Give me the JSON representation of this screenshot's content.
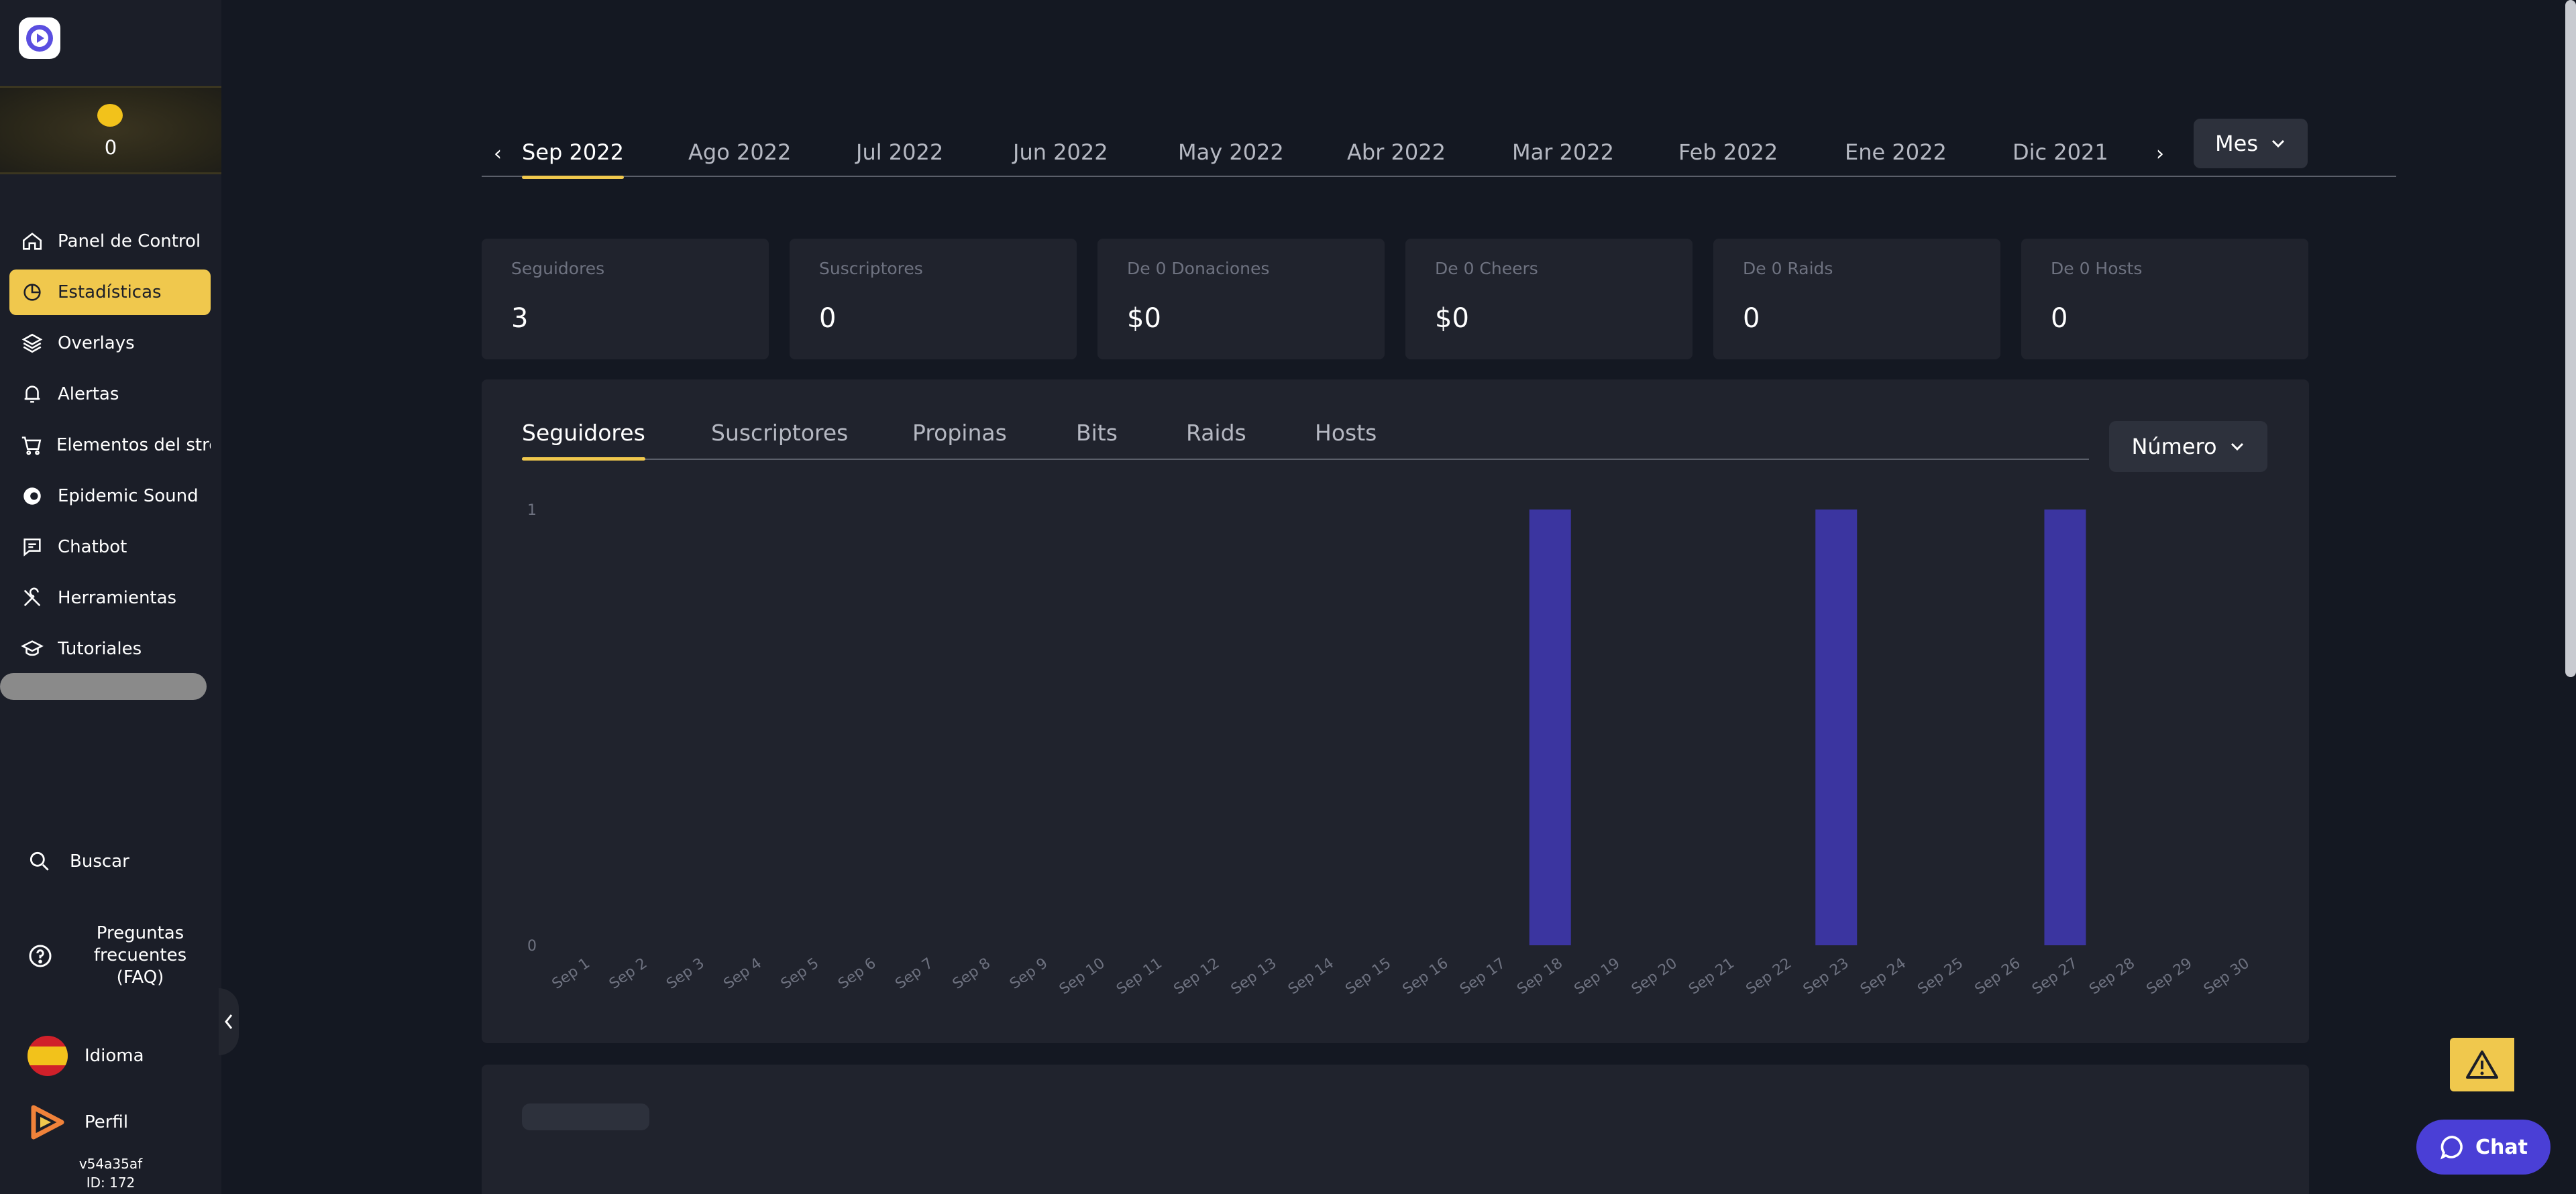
{
  "sidebar": {
    "coins": "0",
    "nav": [
      {
        "label": "Panel de Control",
        "icon": "home-icon"
      },
      {
        "label": "Estadísticas",
        "icon": "pie-chart-icon",
        "active": true
      },
      {
        "label": "Overlays",
        "icon": "layers-icon"
      },
      {
        "label": "Alertas",
        "icon": "bell-icon"
      },
      {
        "label": "Elementos del strea",
        "icon": "cart-icon"
      },
      {
        "label": "Epidemic Sound",
        "icon": "epidemic-sound-icon"
      },
      {
        "label": "Chatbot",
        "icon": "chat-bubble-icon"
      },
      {
        "label": "Herramientas",
        "icon": "tools-icon"
      },
      {
        "label": "Tutoriales",
        "icon": "graduation-cap-icon"
      }
    ],
    "search": "Buscar",
    "faq": "Preguntas frecuentes (FAQ)",
    "language": "Idioma",
    "profile": "Perfil",
    "version": "v54a35af",
    "id": "ID: 172"
  },
  "months": [
    "Sep 2022",
    "Ago 2022",
    "Jul 2022",
    "Jun 2022",
    "May 2022",
    "Abr 2022",
    "Mar 2022",
    "Feb 2022",
    "Ene 2022",
    "Dic 2021"
  ],
  "period_select": "Mes",
  "stats": [
    {
      "title": "Seguidores",
      "value": "3"
    },
    {
      "title": "Suscriptores",
      "value": "0"
    },
    {
      "title": "De 0 Donaciones",
      "value": "$0"
    },
    {
      "title": "De 0 Cheers",
      "value": "$0"
    },
    {
      "title": "De 0 Raids",
      "value": "0"
    },
    {
      "title": "De 0 Hosts",
      "value": "0"
    }
  ],
  "chart_tabs": [
    "Seguidores",
    "Suscriptores",
    "Propinas",
    "Bits",
    "Raids",
    "Hosts"
  ],
  "metric_select": "Número",
  "chat_label": "Chat",
  "colors": {
    "accent": "#f0c84d",
    "bar": "#3b35a0",
    "chat": "#4a3fd6"
  },
  "chart_data": {
    "type": "bar",
    "categories": [
      "Sep 1",
      "Sep 2",
      "Sep 3",
      "Sep 4",
      "Sep 5",
      "Sep 6",
      "Sep 7",
      "Sep 8",
      "Sep 9",
      "Sep 10",
      "Sep 11",
      "Sep 12",
      "Sep 13",
      "Sep 14",
      "Sep 15",
      "Sep 16",
      "Sep 17",
      "Sep 18",
      "Sep 19",
      "Sep 20",
      "Sep 21",
      "Sep 22",
      "Sep 23",
      "Sep 24",
      "Sep 25",
      "Sep 26",
      "Sep 27",
      "Sep 28",
      "Sep 29",
      "Sep 30"
    ],
    "values": [
      0,
      0,
      0,
      0,
      0,
      0,
      0,
      0,
      0,
      0,
      0,
      0,
      0,
      0,
      0,
      0,
      0,
      1,
      0,
      0,
      0,
      0,
      1,
      0,
      0,
      0,
      1,
      0,
      0,
      0
    ],
    "yticks": [
      "0",
      "1"
    ],
    "ylim": [
      0,
      1
    ]
  }
}
